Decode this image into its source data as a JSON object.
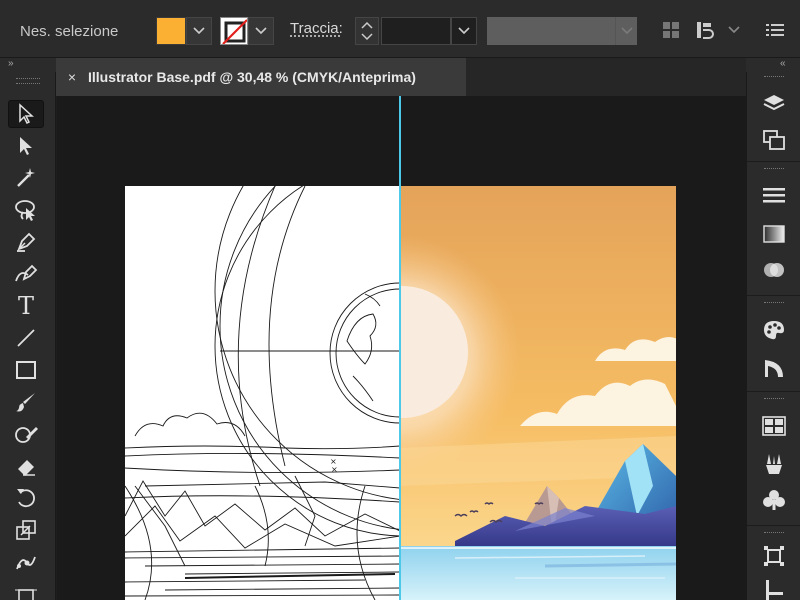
{
  "control_bar": {
    "selection_label": "Nes. selezione",
    "fill_color": "#fbb034",
    "stroke_label": "Traccia:",
    "stroke_weight": "",
    "icons": [
      "fill-dropdown-icon",
      "stroke-none-icon",
      "stroke-dropdown-icon",
      "stepper-icon",
      "align-grid-icon",
      "transform-icon",
      "chevron-down-icon",
      "menu-list-icon"
    ]
  },
  "document": {
    "tab_close": "×",
    "tab_title": "Illustrator Base.pdf @ 30,48 % (CMYK/Anteprima)"
  },
  "panel_toggles": {
    "left": "»",
    "right": "«"
  },
  "tools": [
    {
      "name": "selection-tool-icon",
      "active": true
    },
    {
      "name": "direct-selection-tool-icon",
      "active": false
    },
    {
      "name": "magic-wand-tool-icon",
      "active": false
    },
    {
      "name": "lasso-tool-icon",
      "active": false
    },
    {
      "name": "pen-tool-icon",
      "active": false
    },
    {
      "name": "curvature-tool-icon",
      "active": false
    },
    {
      "name": "type-tool-icon",
      "active": false
    },
    {
      "name": "line-tool-icon",
      "active": false
    },
    {
      "name": "rectangle-tool-icon",
      "active": false
    },
    {
      "name": "paintbrush-tool-icon",
      "active": false
    },
    {
      "name": "shaper-tool-icon",
      "active": false
    },
    {
      "name": "eraser-tool-icon",
      "active": false
    },
    {
      "name": "rotate-tool-icon",
      "active": false
    },
    {
      "name": "scale-tool-icon",
      "active": false
    },
    {
      "name": "puppet-warp-tool-icon",
      "active": false
    }
  ],
  "type_tool_glyph": "T",
  "right_panels": [
    "layers-icon",
    "artboards-icon",
    "stroke-panel-icon",
    "gradient-icon",
    "transparency-icon",
    "color-palette-icon",
    "color-guide-icon",
    "swatches-icon",
    "brushes-icon",
    "symbols-icon",
    "align-icon",
    "transform-panel-icon"
  ],
  "colors": {
    "accent_guide": "#4cc9e8",
    "sky_top": "#e4a35a",
    "sky_bottom": "#fbd58a",
    "mountain_blue": "#3f8fd0",
    "water": "#bfe7f4"
  }
}
